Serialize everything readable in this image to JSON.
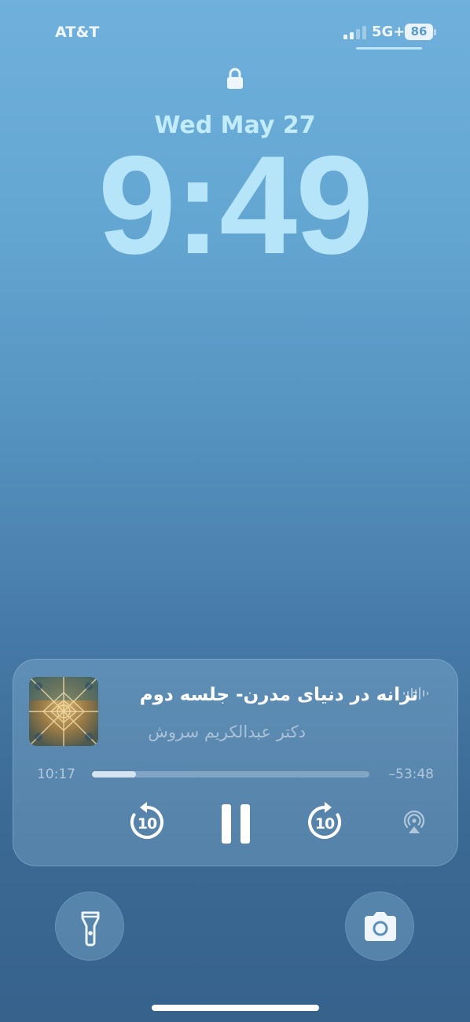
{
  "status_bar": {
    "carrier": "AT&T",
    "network": "5G+",
    "battery_percent": "86",
    "signal_bars_active": 2,
    "signal_bars_total": 4
  },
  "lock_screen": {
    "lock_icon": "lock-icon",
    "date": "Wed May 27",
    "time": "9:49"
  },
  "now_playing": {
    "title": "ترانه در دنیای مدرن- جلسه دوم",
    "artist": "دکتر عبدالکریم سروش",
    "elapsed": "10:17",
    "remaining": "–53:48",
    "progress_fraction": 0.158,
    "skip_back_seconds": "10",
    "skip_forward_seconds": "10",
    "state": "playing",
    "icons": [
      "waveform-icon",
      "skip-back-10-icon",
      "pause-icon",
      "skip-forward-10-icon",
      "airplay-icon"
    ]
  },
  "quick_actions": {
    "left_icon": "flashlight-icon",
    "right_icon": "camera-icon"
  },
  "colors": {
    "clock": "#b6e4f8",
    "date": "#c3ecfb",
    "background_top": "#6fb1dc",
    "background_bottom": "#36628c"
  }
}
